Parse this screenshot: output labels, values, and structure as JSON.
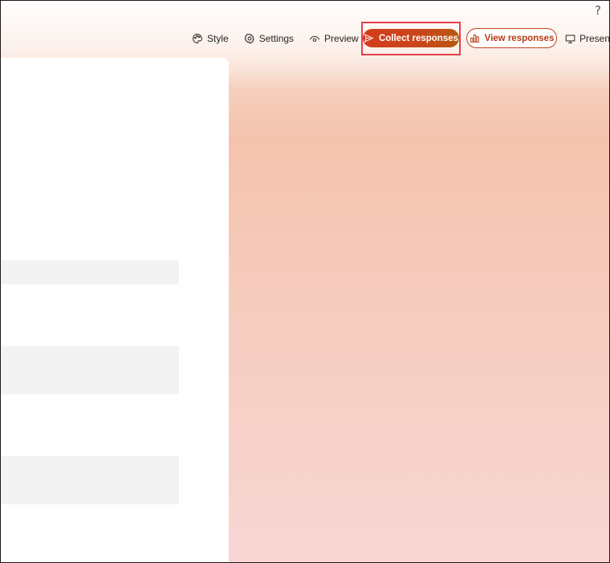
{
  "window": {
    "help_label": "?"
  },
  "toolbar": {
    "style": {
      "label": "Style",
      "icon": "palette-icon"
    },
    "settings": {
      "label": "Settings",
      "icon": "gear-icon"
    },
    "preview": {
      "label": "Preview",
      "icon": "eye-icon"
    },
    "collect": {
      "label": "Collect responses",
      "icon": "send-icon"
    },
    "view": {
      "label": "View responses",
      "icon": "bar-chart-icon"
    },
    "present": {
      "label": "Present",
      "icon": "monitor-icon"
    }
  },
  "colors": {
    "accent": "#c9461c",
    "highlight_box": "#e5404c",
    "background_top": "#f4c3ad",
    "background_bottom": "#f8d6d4",
    "field_fill": "#f3f3f3"
  },
  "form": {
    "fields": [
      {
        "name": "field-1",
        "value": ""
      },
      {
        "name": "field-2",
        "value": ""
      },
      {
        "name": "field-3",
        "value": ""
      }
    ]
  }
}
